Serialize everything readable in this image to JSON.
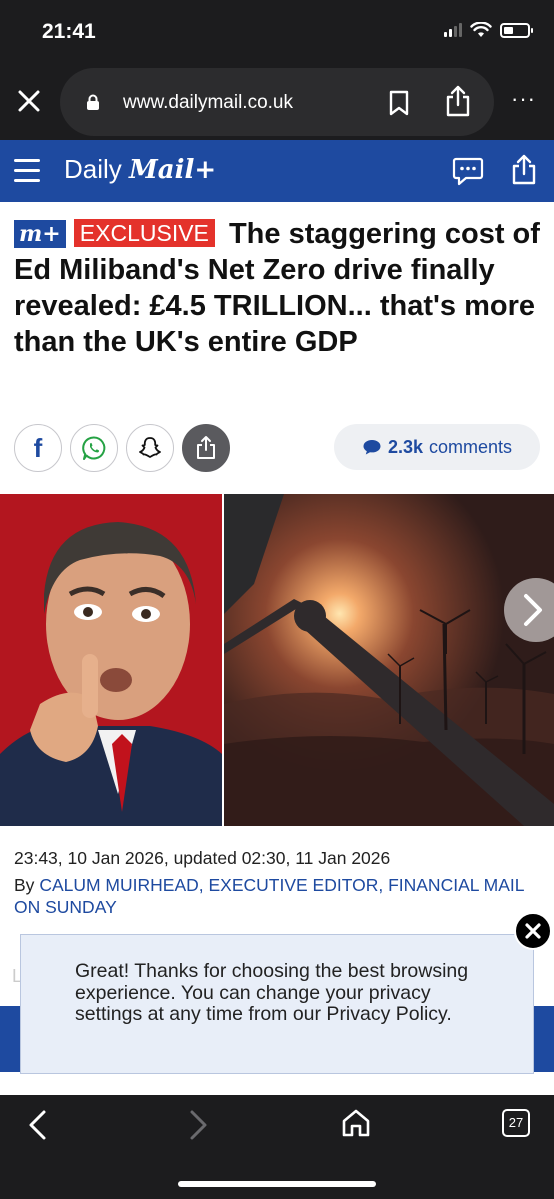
{
  "status_bar": {
    "time": "21:41"
  },
  "browser": {
    "url": "www.dailymail.co.uk",
    "more_label": "···"
  },
  "site": {
    "logo_prefix": "Daily",
    "logo_brand": "Mail+"
  },
  "article": {
    "badge_mplus": "m+",
    "badge_exclusive": "EXCLUSIVE",
    "headline": "The staggering cost of Ed Miliband's Net Zero drive finally revealed: £4.5 TRILLION... that's more than the UK's entire GDP",
    "share": {
      "facebook_letter": "f"
    },
    "comments_count": "2.3k",
    "comments_label": "comments",
    "dateline": "23:43, 10 Jan 2026, updated 02:30, 11 Jan 2026",
    "byline_prefix": "By",
    "byline_author": "CALUM MUIRHEAD, EXECUTIVE EDITOR, FINANCIAL MAIL ON SUNDAY",
    "faded_text": "L"
  },
  "privacy_toast": {
    "message": "Great! Thanks for choosing the best browsing experience. You can change your privacy settings at any time from our Privacy Policy."
  },
  "toolbar": {
    "tab_count": "27"
  },
  "colors": {
    "brand_blue": "#1e4aa0",
    "exclusive_red": "#e4322b",
    "chrome_dark": "#1c1c1e"
  }
}
